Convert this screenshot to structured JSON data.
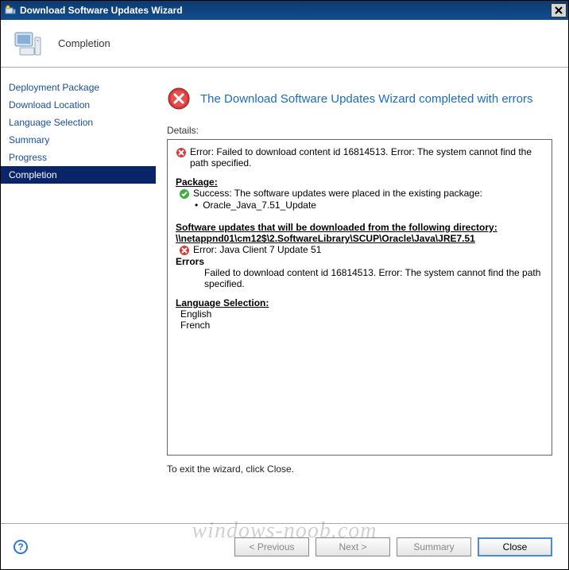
{
  "window": {
    "title": "Download Software Updates Wizard"
  },
  "header": {
    "page_title": "Completion"
  },
  "sidebar": {
    "items": [
      {
        "label": "Deployment Package"
      },
      {
        "label": "Download Location"
      },
      {
        "label": "Language Selection"
      },
      {
        "label": "Summary"
      },
      {
        "label": "Progress"
      },
      {
        "label": "Completion"
      }
    ],
    "selected_index": 5
  },
  "result": {
    "status": "error",
    "message": "The Download Software Updates Wizard completed with errors"
  },
  "details_label": "Details:",
  "details": {
    "top_error": "Error: Failed to download content id 16814513. Error: The system cannot find the path specified.",
    "package_heading": "Package:",
    "package_success": "Success: The software updates were placed in the existing package:",
    "package_name": "Oracle_Java_7.51_Update",
    "download_heading": "Software updates that will be downloaded from the following directory: \\\\netappnd01\\cm12$\\2.SoftwareLibrary\\SCUP\\Oracle\\Java\\JRE7.51",
    "item_error": "Error: Java Client 7 Update 51",
    "errors_heading": "Errors",
    "errors_body": "Failed to download content id 16814513. Error: The system cannot find the path specified.",
    "lang_heading": "Language Selection:",
    "languages": [
      "English",
      "French"
    ]
  },
  "exit_text": "To exit the wizard, click Close.",
  "buttons": {
    "previous": "< Previous",
    "next": "Next >",
    "summary": "Summary",
    "close": "Close"
  },
  "watermark": "windows-noob.com"
}
